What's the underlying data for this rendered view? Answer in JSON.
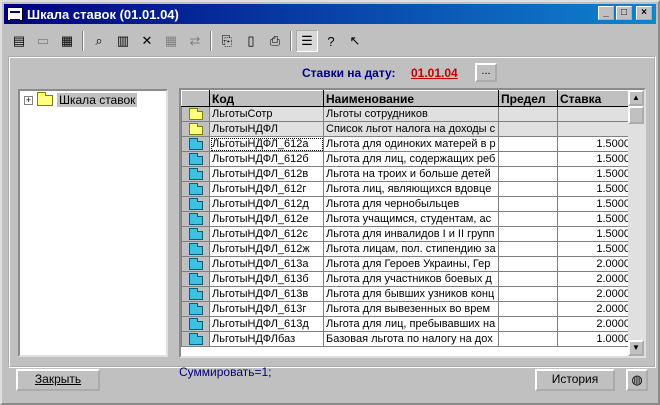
{
  "window": {
    "title": "Шкала ставок (01.01.04)",
    "min": "_",
    "max": "□",
    "close": "×"
  },
  "toolbar": [
    {
      "icon": "new-icon",
      "glyph": "▤"
    },
    {
      "icon": "open-folder-icon",
      "glyph": "▭",
      "disabled": true
    },
    {
      "icon": "edit-icon",
      "glyph": "▦"
    },
    {
      "icon": "find-icon",
      "glyph": "⌕"
    },
    {
      "icon": "add-row-icon",
      "glyph": "▥"
    },
    {
      "icon": "delete-row-icon",
      "glyph": "✕"
    },
    {
      "icon": "copy-disabled-icon",
      "glyph": "▦",
      "disabled": true
    },
    {
      "icon": "move-icon",
      "glyph": "⇄",
      "disabled": true
    },
    {
      "icon": "copy-icon",
      "glyph": "⎘"
    },
    {
      "icon": "document-icon",
      "glyph": "▯"
    },
    {
      "icon": "print-icon",
      "glyph": "⎙"
    },
    {
      "icon": "tree-view-icon",
      "glyph": "☰",
      "pressed": true
    },
    {
      "icon": "help-icon",
      "glyph": "?"
    },
    {
      "icon": "context-help-icon",
      "glyph": "↖"
    }
  ],
  "rate": {
    "label": "Ставки на дату:",
    "date": "01.01.04",
    "button": "..."
  },
  "tree": {
    "root": "Шкала ставок",
    "expand": "+"
  },
  "grid": {
    "columns": [
      "Код",
      "Наименование",
      "Предел",
      "Ставка"
    ],
    "rows": [
      {
        "type": "group",
        "code": "ЛьготыСотр",
        "name": "Льготы сотрудников",
        "limit": "",
        "rate": ""
      },
      {
        "type": "group",
        "code": "ЛьготыНДФЛ",
        "name": "Список льгот налога на доходы с",
        "limit": "",
        "rate": ""
      },
      {
        "type": "item",
        "code": "ЛьготыНДФЛ_612а",
        "name": "Льгота для одиноких матерей в р",
        "limit": "",
        "rate": "1.5000",
        "selected": true
      },
      {
        "type": "item",
        "code": "ЛьготыНДФЛ_612б",
        "name": "Льгота для лиц, содержащих реб",
        "limit": "",
        "rate": "1.5000"
      },
      {
        "type": "item",
        "code": "ЛьготыНДФЛ_612в",
        "name": "Льгота на троих и больше детей",
        "limit": "",
        "rate": "1.5000"
      },
      {
        "type": "item",
        "code": "ЛьготыНДФЛ_612г",
        "name": "Льгота лиц, являющихся вдовце",
        "limit": "",
        "rate": "1.5000"
      },
      {
        "type": "item",
        "code": "ЛьготыНДФЛ_612д",
        "name": "Льгота для чернобыльцев",
        "limit": "",
        "rate": "1.5000"
      },
      {
        "type": "item",
        "code": "ЛьготыНДФЛ_612е",
        "name": "Льгота учащимся, студентам, ас",
        "limit": "",
        "rate": "1.5000"
      },
      {
        "type": "item",
        "code": "ЛьготыНДФЛ_612є",
        "name": "Льгота для инвалидов I и II групп",
        "limit": "",
        "rate": "1.5000"
      },
      {
        "type": "item",
        "code": "ЛьготыНДФЛ_612ж",
        "name": "Льгота лицам, пол. стипендию за",
        "limit": "",
        "rate": "1.5000"
      },
      {
        "type": "item",
        "code": "ЛьготыНДФЛ_613а",
        "name": "Льгота для Героев Украины, Гер",
        "limit": "",
        "rate": "2.0000"
      },
      {
        "type": "item",
        "code": "ЛьготыНДФЛ_613б",
        "name": "Льгота для участников боевых д",
        "limit": "",
        "rate": "2.0000"
      },
      {
        "type": "item",
        "code": "ЛьготыНДФЛ_613в",
        "name": "Льгота для бывших узников конц",
        "limit": "",
        "rate": "2.0000"
      },
      {
        "type": "item",
        "code": "ЛьготыНДФЛ_613г",
        "name": "Льгота для вывезенных во врем",
        "limit": "",
        "rate": "2.0000"
      },
      {
        "type": "item",
        "code": "ЛьготыНДФЛ_613д",
        "name": "Льгота для лиц, пребывавших на",
        "limit": "",
        "rate": "2.0000"
      },
      {
        "type": "item",
        "code": "ЛьготыНДФЛбаз",
        "name": "Базовая льгота по налогу на дох",
        "limit": "",
        "rate": "1.0000"
      }
    ]
  },
  "summary": "Суммировать=1;",
  "buttons": {
    "close": "Закрыть",
    "history": "История"
  }
}
